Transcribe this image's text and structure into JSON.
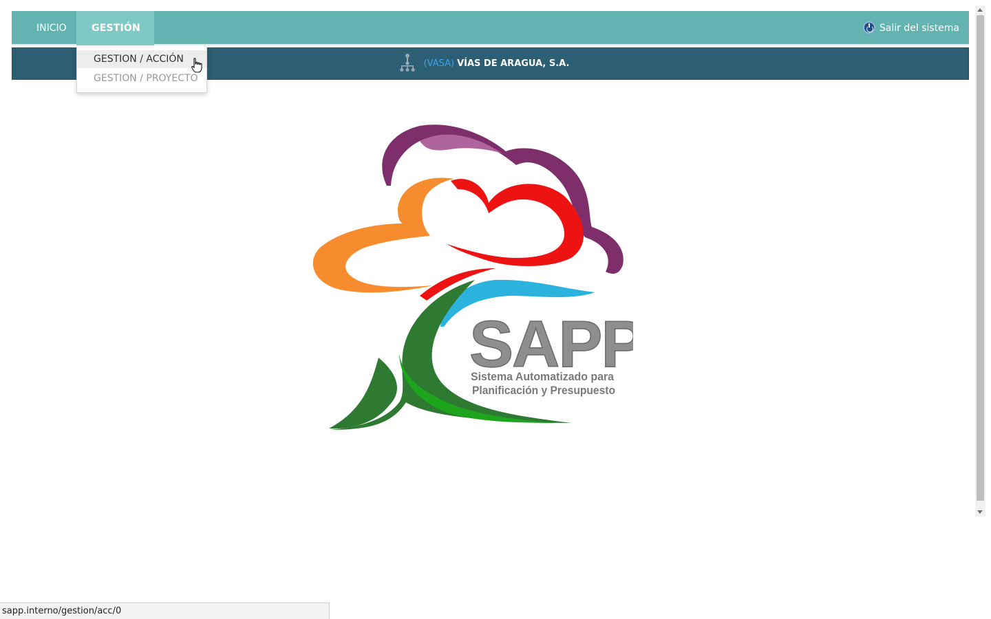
{
  "navbar": {
    "inicio_label": "INICIO",
    "gestion_label": "GESTIÓN",
    "exit_label": "Salir del sistema"
  },
  "dropdown": {
    "items": [
      {
        "label": "GESTION / ACCIÓN"
      },
      {
        "label": "GESTION / PROYECTO"
      }
    ]
  },
  "org": {
    "code": "(VASA)",
    "name": "VÍAS DE ARAGUA, S.A."
  },
  "logo": {
    "title": "SAPP",
    "subtitle_line1": "Sistema Automatizado para",
    "subtitle_line2": "Planificación y Presupuesto"
  },
  "statusbar": {
    "url": "sapp.interno/gestion/acc/0"
  },
  "colors": {
    "navbar": "#63b3b0",
    "navbar_active": "#7fc8c4",
    "orgbar": "#2c5f74",
    "org_code": "#3da3e8"
  },
  "icons": [
    "power-icon",
    "org-chart-icon",
    "hand-pointer-icon",
    "caret-down-icon"
  ]
}
